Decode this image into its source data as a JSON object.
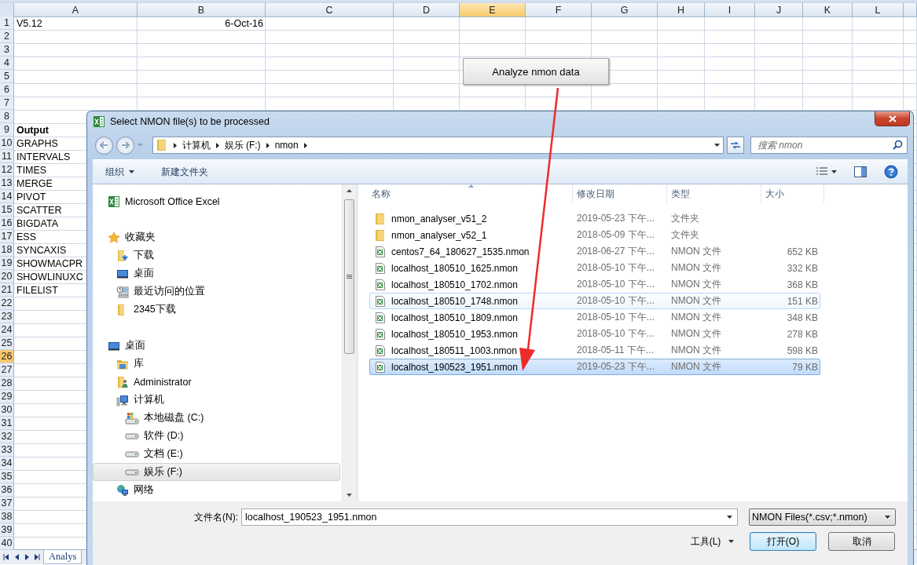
{
  "sheet": {
    "columns": [
      {
        "label": "A",
        "selected": false
      },
      {
        "label": "B",
        "selected": false
      },
      {
        "label": "C",
        "selected": false
      },
      {
        "label": "D",
        "selected": false
      },
      {
        "label": "E",
        "selected": true
      },
      {
        "label": "F",
        "selected": false
      },
      {
        "label": "G",
        "selected": false
      },
      {
        "label": "H",
        "selected": false
      },
      {
        "label": "I",
        "selected": false
      },
      {
        "label": "J",
        "selected": false
      },
      {
        "label": "K",
        "selected": false
      },
      {
        "label": "L",
        "selected": false
      }
    ],
    "rows": [
      {
        "number": "1",
        "selected": false,
        "cells": [
          {
            "text": "V5.12",
            "kind": "text"
          },
          {
            "text": "6-Oct-16",
            "kind": "date"
          }
        ]
      },
      {
        "number": "2",
        "selected": false
      },
      {
        "number": "3",
        "selected": false
      },
      {
        "number": "4",
        "selected": false
      },
      {
        "number": "5",
        "selected": false
      },
      {
        "number": "6",
        "selected": false
      },
      {
        "number": "7",
        "selected": false
      },
      {
        "number": "8",
        "selected": false
      },
      {
        "number": "9",
        "selected": false,
        "cells": [
          {
            "text": "Output",
            "kind": "heading"
          }
        ]
      },
      {
        "number": "10",
        "selected": false,
        "cells": [
          {
            "text": "GRAPHS",
            "kind": "text"
          }
        ]
      },
      {
        "number": "11",
        "selected": false,
        "cells": [
          {
            "text": "INTERVALS",
            "kind": "text"
          }
        ]
      },
      {
        "number": "12",
        "selected": false,
        "cells": [
          {
            "text": "TIMES",
            "kind": "text"
          }
        ]
      },
      {
        "number": "13",
        "selected": false,
        "cells": [
          {
            "text": "MERGE",
            "kind": "text"
          }
        ]
      },
      {
        "number": "14",
        "selected": false,
        "cells": [
          {
            "text": "PIVOT",
            "kind": "text"
          }
        ]
      },
      {
        "number": "15",
        "selected": false,
        "cells": [
          {
            "text": "SCATTER",
            "kind": "text"
          }
        ]
      },
      {
        "number": "16",
        "selected": false,
        "cells": [
          {
            "text": "BIGDATA",
            "kind": "text"
          }
        ]
      },
      {
        "number": "17",
        "selected": false,
        "cells": [
          {
            "text": "ESS",
            "kind": "text"
          }
        ]
      },
      {
        "number": "18",
        "selected": false,
        "cells": [
          {
            "text": "SYNCAXIS",
            "kind": "text"
          }
        ]
      },
      {
        "number": "19",
        "selected": false,
        "cells": [
          {
            "text": "SHOWMACPR",
            "kind": "text"
          }
        ]
      },
      {
        "number": "20",
        "selected": false,
        "cells": [
          {
            "text": "SHOWLINUXC",
            "kind": "text"
          }
        ]
      },
      {
        "number": "21",
        "selected": false,
        "cells": [
          {
            "text": "FILELIST",
            "kind": "text"
          }
        ]
      },
      {
        "number": "22",
        "selected": false
      },
      {
        "number": "23",
        "selected": false
      },
      {
        "number": "24",
        "selected": false
      },
      {
        "number": "25",
        "selected": false
      },
      {
        "number": "26",
        "selected": true
      },
      {
        "number": "27",
        "selected": false
      },
      {
        "number": "28",
        "selected": false
      },
      {
        "number": "29",
        "selected": false
      },
      {
        "number": "30",
        "selected": false
      },
      {
        "number": "31",
        "selected": false
      },
      {
        "number": "32",
        "selected": false
      },
      {
        "number": "33",
        "selected": false
      },
      {
        "number": "34",
        "selected": false
      },
      {
        "number": "35",
        "selected": false
      },
      {
        "number": "36",
        "selected": false
      },
      {
        "number": "37",
        "selected": false
      },
      {
        "number": "38",
        "selected": false
      },
      {
        "number": "39",
        "selected": false
      },
      {
        "number": "40",
        "selected": false
      }
    ],
    "sheet_tabs": [
      {
        "label": "Analys",
        "selected": true
      }
    ]
  },
  "analyze_button": {
    "label": "Analyze nmon data"
  },
  "dialog": {
    "title": "Select NMON file(s) to be processed",
    "breadcrumb": [
      "计算机",
      "娱乐 (F:)",
      "nmon"
    ],
    "search": {
      "placeholder": "搜索 nmon"
    },
    "toolbar": [
      {
        "label": "组织",
        "dropdown": true
      },
      {
        "label": "新建文件夹",
        "dropdown": false
      }
    ],
    "nav": [
      {
        "label": "Microsoft Office Excel",
        "kind": "excel",
        "selected": false
      },
      {
        "label": "收藏夹",
        "kind": "star",
        "selected": false,
        "children": [
          {
            "label": "下载",
            "kind": "download",
            "selected": false
          },
          {
            "label": "桌面",
            "kind": "desktop",
            "selected": false
          },
          {
            "label": "最近访问的位置",
            "kind": "recent",
            "selected": false
          },
          {
            "label": "2345下载",
            "kind": "folder",
            "selected": false
          }
        ]
      },
      {
        "label": "桌面",
        "kind": "desktop",
        "selected": false,
        "children": [
          {
            "label": "库",
            "kind": "library",
            "selected": false
          },
          {
            "label": "Administrator",
            "kind": "user",
            "selected": false
          },
          {
            "label": "计算机",
            "kind": "computer",
            "selected": false,
            "children": [
              {
                "label": "本地磁盘 (C:)",
                "kind": "system-drive",
                "selected": false
              },
              {
                "label": "软件 (D:)",
                "kind": "drive",
                "selected": false
              },
              {
                "label": "文档 (E:)",
                "kind": "drive",
                "selected": false
              },
              {
                "label": "娱乐 (F:)",
                "kind": "drive",
                "selected": true
              }
            ]
          },
          {
            "label": "网络",
            "kind": "network",
            "selected": false
          }
        ]
      }
    ],
    "file_columns": [
      {
        "label": "名称",
        "sorted": true
      },
      {
        "label": "修改日期",
        "sorted": false
      },
      {
        "label": "类型",
        "sorted": false
      },
      {
        "label": "大小",
        "sorted": false
      }
    ],
    "files": [
      {
        "name": "nmon_analyser_v51_2",
        "date": "2019-05-23 下午...",
        "type": "文件夹",
        "kind": "folder",
        "selected": false,
        "hover": false
      },
      {
        "name": "nmon_analyser_v52_1",
        "date": "2018-05-09 下午...",
        "type": "文件夹",
        "kind": "folder",
        "selected": false,
        "hover": false
      },
      {
        "name": "centos7_64_180627_1535.nmon",
        "date": "2018-06-27 下午...",
        "type": "NMON 文件",
        "size": "652 KB",
        "kind": "file",
        "selected": false,
        "hover": false
      },
      {
        "name": "localhost_180510_1625.nmon",
        "date": "2018-05-10 下午...",
        "type": "NMON 文件",
        "size": "332 KB",
        "kind": "file",
        "selected": false,
        "hover": false
      },
      {
        "name": "localhost_180510_1702.nmon",
        "date": "2018-05-10 下午...",
        "type": "NMON 文件",
        "size": "368 KB",
        "kind": "file",
        "selected": false,
        "hover": false
      },
      {
        "name": "localhost_180510_1748.nmon",
        "date": "2018-05-10 下午...",
        "type": "NMON 文件",
        "size": "151 KB",
        "kind": "file",
        "selected": false,
        "hover": true
      },
      {
        "name": "localhost_180510_1809.nmon",
        "date": "2018-05-10 下午...",
        "type": "NMON 文件",
        "size": "348 KB",
        "kind": "file",
        "selected": false,
        "hover": false
      },
      {
        "name": "localhost_180510_1953.nmon",
        "date": "2018-05-10 下午...",
        "type": "NMON 文件",
        "size": "278 KB",
        "kind": "file",
        "selected": false,
        "hover": false
      },
      {
        "name": "localhost_180511_1003.nmon",
        "date": "2018-05-11 下午...",
        "type": "NMON 文件",
        "size": "598 KB",
        "kind": "file",
        "selected": false,
        "hover": false
      },
      {
        "name": "localhost_190523_1951.nmon",
        "date": "2019-05-23 下午...",
        "type": "NMON 文件",
        "size": "79 KB",
        "kind": "file",
        "selected": true,
        "hover": false
      }
    ],
    "file_name": {
      "label": "文件名(N):",
      "value": "localhost_190523_1951.nmon"
    },
    "file_type": {
      "value": "NMON Files(*.csv;*.nmon)"
    },
    "buttons": [
      {
        "label": "工具(L)",
        "kind": "menu"
      },
      {
        "label": "打开(O)",
        "kind": "default"
      },
      {
        "label": "取消",
        "kind": "normal"
      }
    ]
  }
}
